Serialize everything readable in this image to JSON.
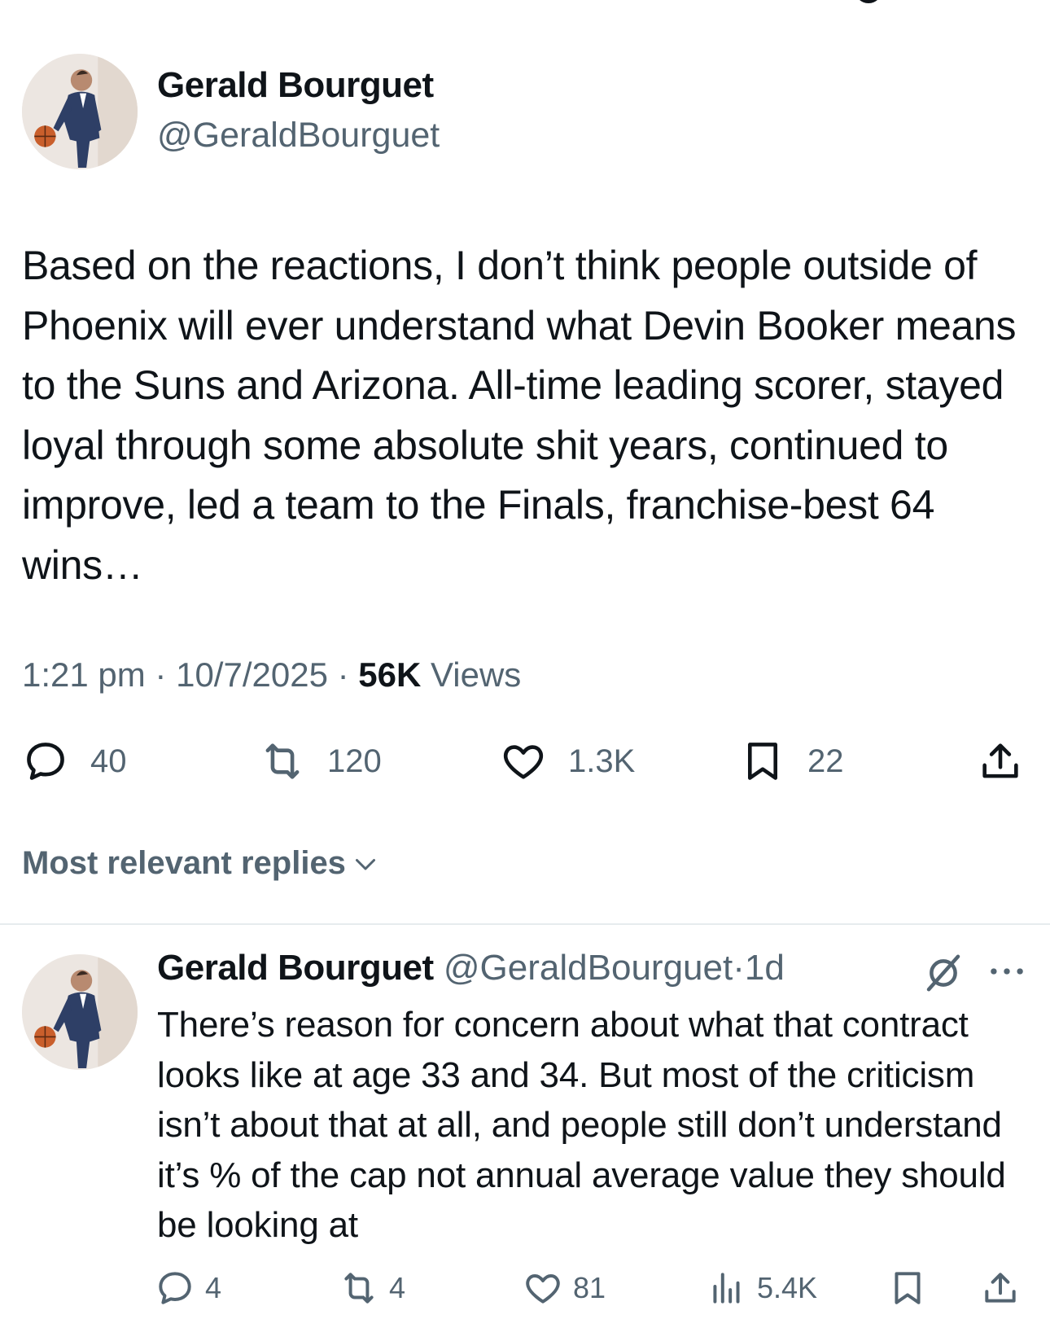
{
  "main": {
    "author_name": "Gerald Bourguet",
    "author_handle": "@GeraldBourguet",
    "text": "Based on the reactions, I don’t think people outside of Phoenix will ever understand what Devin Booker means to the Suns and Arizona. All-time leading scorer, stayed loyal through some absolute shit years, continued to improve, led a team to the Finals, franchise-best 64 wins…",
    "time": "1:21 pm",
    "sep1": " · ",
    "date": "10/7/2025",
    "sep2": " · ",
    "views_count": "56K",
    "views_label": " Views",
    "actions": {
      "replies": "40",
      "reposts": "120",
      "likes": "1.3K",
      "bookmarks": "22"
    }
  },
  "replies_filter": {
    "label": "Most relevant replies"
  },
  "reply": {
    "author_name": "Gerald Bourguet",
    "author_handle": "@GeraldBourguet",
    "sep": "·",
    "age": "1d",
    "text": "There’s reason for concern about what that contract looks like at age 33 and 34. But most of the criticism isn’t about that at all, and people still don’t understand it’s % of the cap not annual average value they should be looking at",
    "actions": {
      "replies": "4",
      "reposts": "4",
      "likes": "81",
      "views": "5.4K"
    }
  },
  "icons": {
    "reply": "reply-icon",
    "repost": "repost-icon",
    "like": "heart-icon",
    "bookmark": "bookmark-icon",
    "share": "share-icon",
    "views": "views-icon",
    "grok": "grok-icon",
    "more": "more-icon",
    "chevron": "chevron-down-icon"
  },
  "colors": {
    "text": "#0f1419",
    "secondary": "#536471",
    "divider": "#e6ebee"
  }
}
